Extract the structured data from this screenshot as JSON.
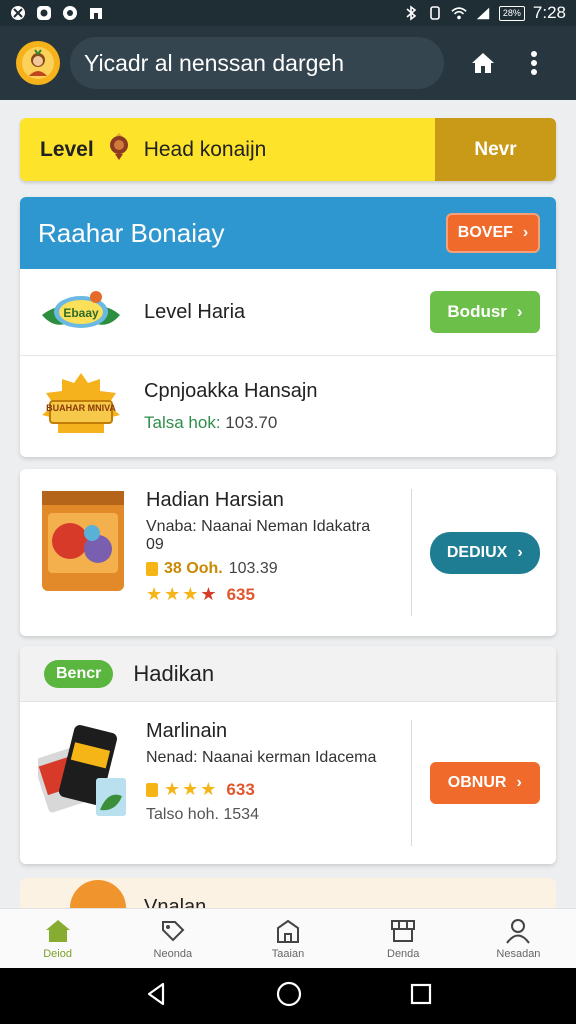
{
  "status_bar": {
    "time": "7:28",
    "battery_label": "28%"
  },
  "app_bar": {
    "search_text": "Yicadr al nenssan dargeh"
  },
  "level_banner": {
    "label": "Level",
    "text": "Head konaijn",
    "button": "Nevr"
  },
  "section": {
    "title": "Raahar Bonaiay",
    "header_button": "BOVEF",
    "row1": {
      "badge_text": "Ebaay",
      "title": "Level Haria",
      "button": "Bodusr"
    },
    "row2": {
      "badge_text": "BUAHAR MNIVA",
      "title": "Cpnjoakka Hansajn",
      "sub_label": "Talsa hok:",
      "sub_value": "103.70"
    }
  },
  "product1": {
    "title": "Hadian Harsian",
    "desc": "Vnaba: Naanai Neman Idakatra 09",
    "price_label": "38 Ooh.",
    "price_value": "103.39",
    "rating_value": "635",
    "button": "DEDIUX"
  },
  "card3": {
    "pill": "Bencr",
    "title": "Hadikan",
    "product": {
      "title": "Marlinain",
      "desc": "Nenad: Naanai kerman Idacema",
      "rating_value": "633",
      "sub": "Talso hoh. 1534",
      "button": "OBNUR"
    }
  },
  "card4": {
    "title": "Vnalan"
  },
  "bottom_nav": [
    {
      "label": "Deiod",
      "icon": "home-icon"
    },
    {
      "label": "Neonda",
      "icon": "tag-icon"
    },
    {
      "label": "Taaian",
      "icon": "building-icon"
    },
    {
      "label": "Denda",
      "icon": "storefront-icon"
    },
    {
      "label": "Nesadan",
      "icon": "user-icon"
    }
  ],
  "colors": {
    "primary": "#2f97cf",
    "accent_orange": "#ef6a2b",
    "accent_green": "#6cc04a",
    "teal": "#1f7d93",
    "banner_yellow": "#fde42b"
  }
}
